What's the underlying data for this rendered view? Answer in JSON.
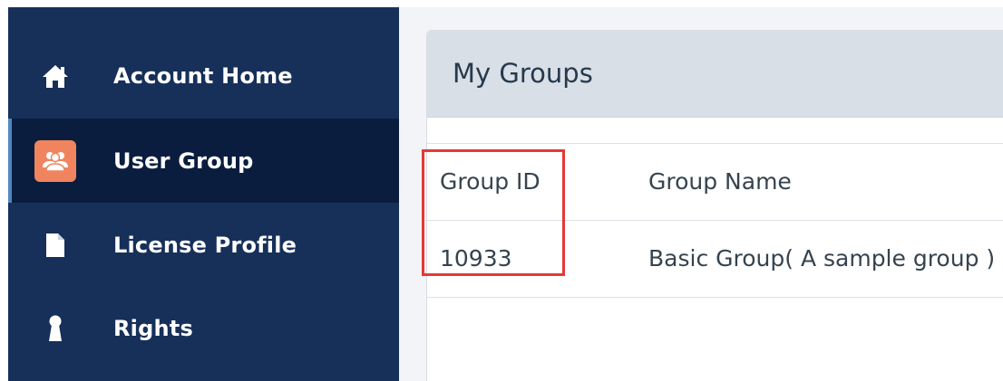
{
  "sidebar": {
    "items": [
      {
        "label": "Account Home",
        "icon": "home-icon",
        "active": false
      },
      {
        "label": "User Group",
        "icon": "user-group-icon",
        "active": true
      },
      {
        "label": "License Profile",
        "icon": "document-icon",
        "active": false
      },
      {
        "label": "Rights",
        "icon": "keyhole-icon",
        "active": false
      }
    ]
  },
  "main": {
    "panel_title": "My Groups",
    "table": {
      "columns": [
        "Group ID",
        "Group Name"
      ],
      "rows": [
        {
          "group_id": "10933",
          "group_name": "Basic Group( A sample group )"
        }
      ]
    }
  },
  "colors": {
    "sidebar_bg": "#17305a",
    "sidebar_active_bg": "#0a1d3e",
    "active_indicator": "#4f88c2",
    "user_group_icon_bg": "#f0845e",
    "panel_header_bg": "#d8dfe7",
    "highlight": "#e53935"
  }
}
